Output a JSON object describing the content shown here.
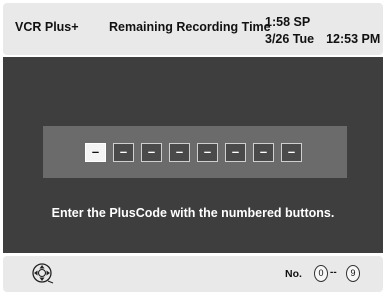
{
  "header": {
    "title": "VCR Plus+",
    "remaining_label": "Remaining Recording Time",
    "remaining_value": "1:58 SP",
    "date": "3/26 Tue",
    "time": "12:53 PM"
  },
  "entry": {
    "digits": [
      "–",
      "–",
      "–",
      "–",
      "–",
      "–",
      "–",
      "–"
    ],
    "instruction": "Enter the PlusCode with the numbered buttons."
  },
  "footer": {
    "no_label": "No.",
    "range_start": "0",
    "range_separator": "--",
    "range_end": "9",
    "nav_icon": "directional-pad-icon"
  },
  "colors": {
    "header_bg": "#e9e9e9",
    "main_bg": "#3e3e3e",
    "panel_bg": "#6b6b6b",
    "active_digit_bg": "#f4f4f4"
  }
}
